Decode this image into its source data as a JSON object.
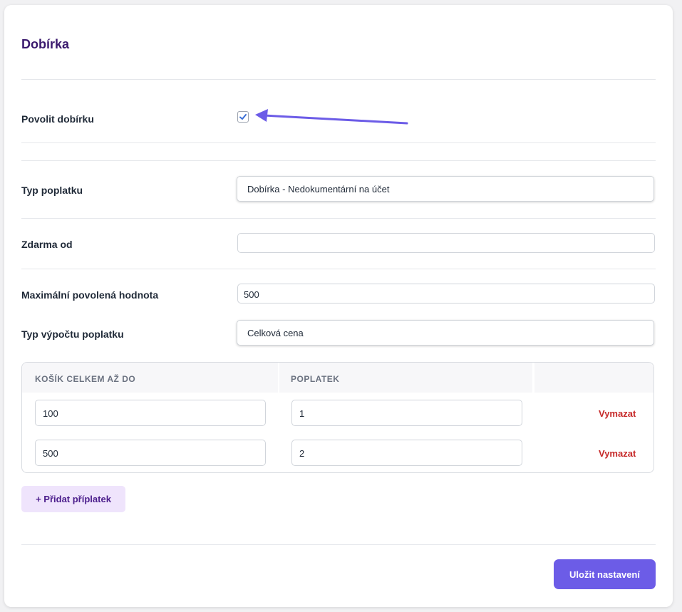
{
  "section": {
    "title": "Dobírka"
  },
  "cod_enabled": {
    "label": "Povolit dobírku",
    "checked": true
  },
  "fee_type": {
    "label": "Typ poplatku",
    "value": "Dobírka - Nedokumentární na účet"
  },
  "free_from": {
    "label": "Zdarma od",
    "value": ""
  },
  "max_value": {
    "label": "Maximální povolená hodnota",
    "value": "500"
  },
  "calc_type": {
    "label": "Typ výpočtu poplatku",
    "value": "Celková cena"
  },
  "surcharge_table": {
    "headers": [
      "KOŠÍK CELKEM AŽ DO",
      "POPLATEK",
      ""
    ],
    "rows": [
      {
        "cart_total": "100",
        "fee": "1",
        "delete_label": "Vymazat"
      },
      {
        "cart_total": "500",
        "fee": "2",
        "delete_label": "Vymazat"
      }
    ]
  },
  "add_button": {
    "label": "+ Přidat příplatek"
  },
  "save_button": {
    "label": "Uložit nastavení"
  },
  "colors": {
    "accent": "#6c5ce7",
    "title": "#3b1a6e",
    "delete": "#c62828",
    "add_button_bg": "#efe4fc",
    "annotation_arrow": "#6c5ce7"
  },
  "icons": {
    "checkbox": "checkmark-icon",
    "annotation": "arrow-annotation-icon"
  }
}
